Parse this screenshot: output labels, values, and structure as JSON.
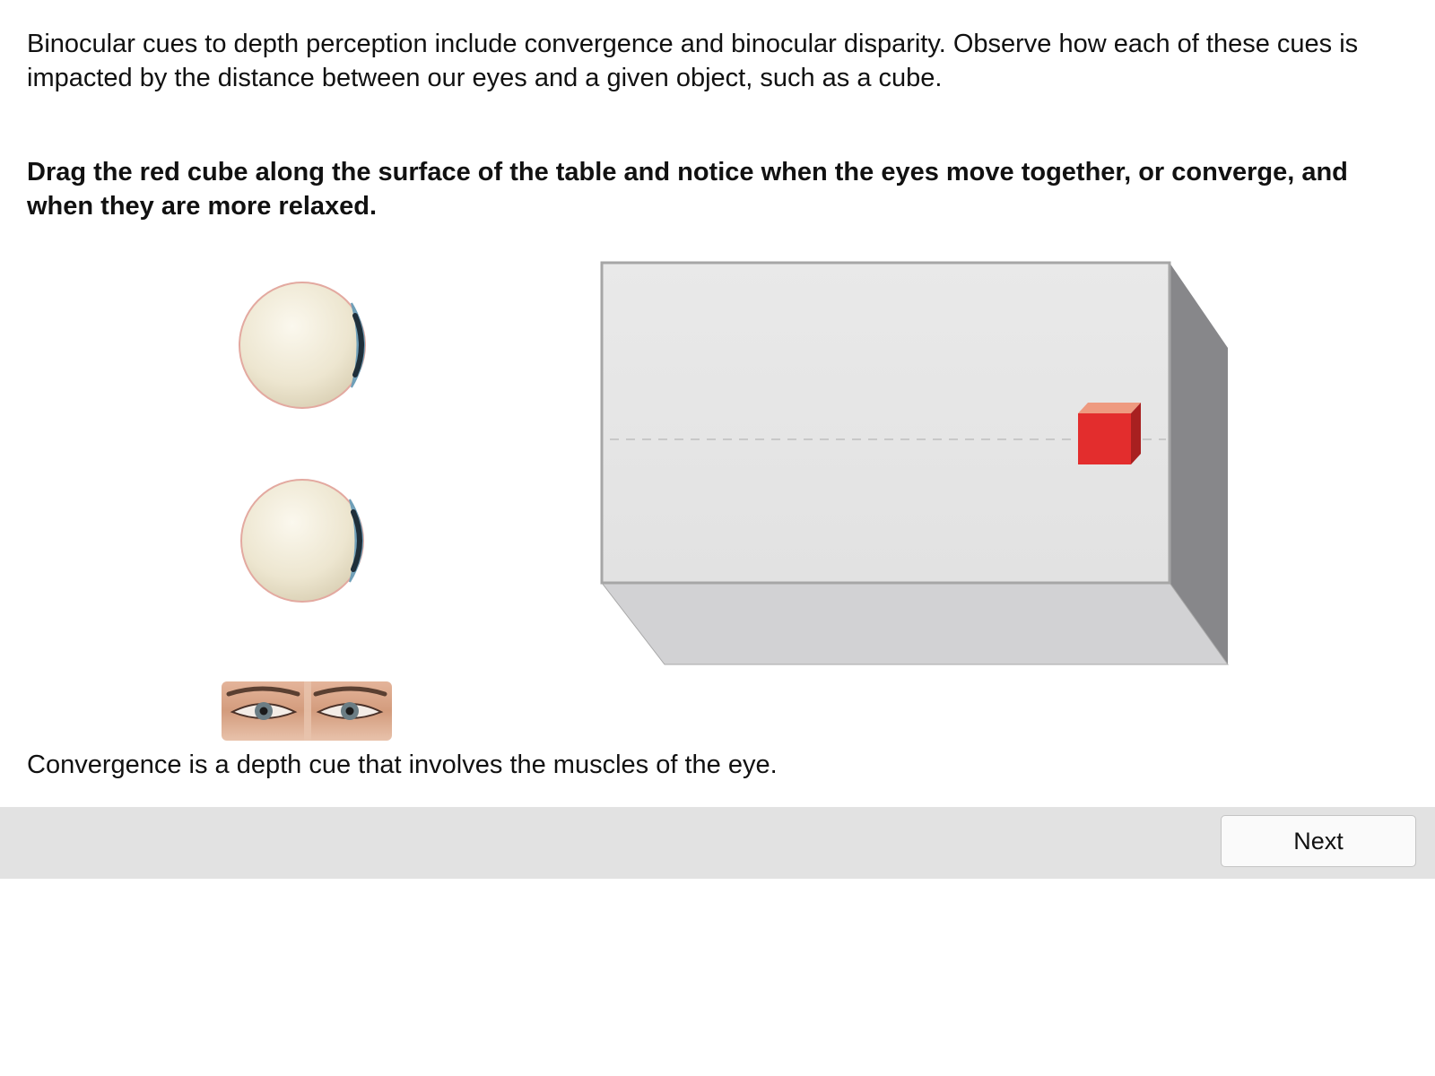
{
  "intro_text": "Binocular cues to depth perception include convergence and binocular disparity. Observe how each of these cues is impacted by the distance between our eyes and a given object, such as a cube.",
  "instruction_text": "Drag the red cube along the surface of the table and notice when the eyes move together, or converge, and when they are more relaxed.",
  "caption_text": "Convergence is a depth cue that involves the muscles of the eye.",
  "footer": {
    "next_label": "Next"
  },
  "simulation": {
    "cube_color": "#e32d2d",
    "table_top_color": "#e6e6e6",
    "table_side_color": "#87878a",
    "table_front_color": "#d2d2d4",
    "eyeball_color": "#f0ead6",
    "icons": [
      "eyeball-top-icon",
      "eyeball-bottom-icon",
      "red-cube",
      "eyes-photo"
    ]
  }
}
